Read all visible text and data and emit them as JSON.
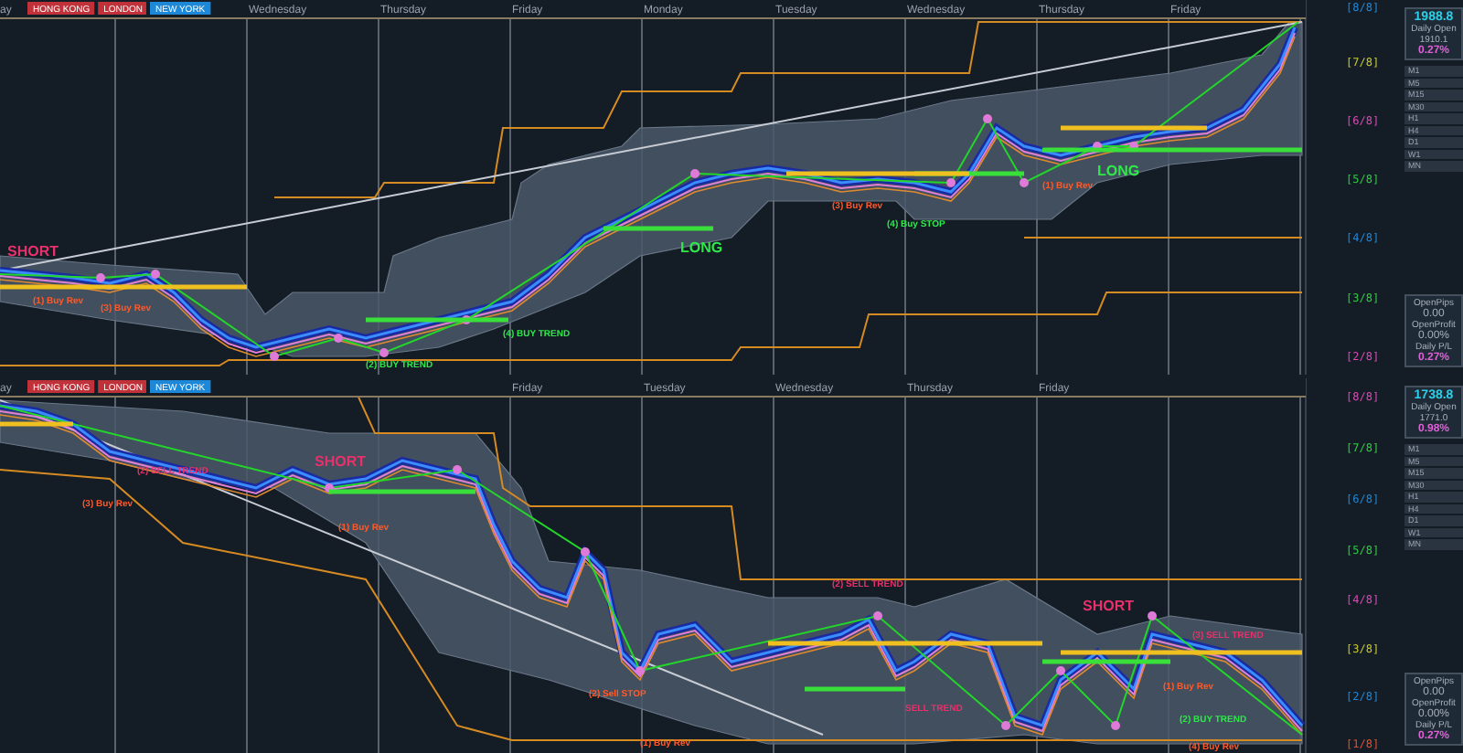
{
  "panels": [
    {
      "day_labels": [
        "ay",
        "Wednesday",
        "Thursday",
        "Friday",
        "Monday",
        "Tuesday",
        "Wednesday",
        "Thursday",
        "Friday"
      ],
      "session_badges": [
        {
          "text": "HONG KONG",
          "color": "#c0313a"
        },
        {
          "text": "LONDON",
          "color": "#c0313a"
        },
        {
          "text": "NEW YORK",
          "color": "#1e88d8"
        }
      ],
      "annotations": [
        {
          "text": "SHORT",
          "kind": "short"
        },
        {
          "text": "(1) Buy Rev",
          "kind": "rev"
        },
        {
          "text": "(3) Buy Rev",
          "kind": "rev"
        },
        {
          "text": "(2) BUY TREND",
          "kind": "trend"
        },
        {
          "text": "(4) BUY TREND",
          "kind": "trend"
        },
        {
          "text": "LONG",
          "kind": "long"
        },
        {
          "text": "(3) Buy Rev",
          "kind": "rev"
        },
        {
          "text": "(4) Buy STOP",
          "kind": "trend"
        },
        {
          "text": "(1) Buy Rev",
          "kind": "rev"
        },
        {
          "text": "LONG",
          "kind": "long"
        }
      ],
      "levels": [
        {
          "text": "[8/8]",
          "color": "#1e88d8"
        },
        {
          "text": "[7/8]",
          "color": "#c8c832"
        },
        {
          "text": "[6/8]",
          "color": "#d84ab4"
        },
        {
          "text": "[5/8]",
          "color": "#2ecc40"
        },
        {
          "text": "[4/8]",
          "color": "#1e88d8"
        },
        {
          "text": "[3/8]",
          "color": "#2ecc40"
        },
        {
          "text": "[2/8]",
          "color": "#d84ab4"
        }
      ],
      "quote_box": [
        "1988.8",
        "Daily Open",
        "1910.1",
        "0.27%"
      ],
      "timeframes": [
        "M1",
        "M5",
        "M15",
        "M30",
        "H1",
        "H4",
        "D1",
        "W1",
        "MN"
      ],
      "pnl_box": [
        "OpenPips",
        "0.00",
        "OpenProfit",
        "0.00%",
        "Daily P/L",
        "0.27%"
      ]
    },
    {
      "day_labels": [
        "ay",
        "Friday",
        "Tuesday",
        "Wednesday",
        "Thursday",
        "Friday"
      ],
      "session_badges": [
        {
          "text": "HONG KONG",
          "color": "#c0313a"
        },
        {
          "text": "LONDON",
          "color": "#c0313a"
        },
        {
          "text": "NEW YORK",
          "color": "#1e88d8"
        }
      ],
      "annotations": [
        {
          "text": "(2) SELL TREND",
          "kind": "short"
        },
        {
          "text": "(3) Buy Rev",
          "kind": "rev"
        },
        {
          "text": "SHORT",
          "kind": "short"
        },
        {
          "text": "(1) Buy Rev",
          "kind": "rev"
        },
        {
          "text": "(2) SELL TREND",
          "kind": "short"
        },
        {
          "text": "(2) Sell STOP",
          "kind": "rev"
        },
        {
          "text": "(1) Buy Rev",
          "kind": "rev"
        },
        {
          "text": "SELL TREND",
          "kind": "short"
        },
        {
          "text": "SHORT",
          "kind": "short"
        },
        {
          "text": "(3) SELL TREND",
          "kind": "short"
        },
        {
          "text": "(1) Buy Rev",
          "kind": "rev"
        },
        {
          "text": "(2) BUY TREND",
          "kind": "trend"
        },
        {
          "text": "(4) Buy Rev",
          "kind": "rev"
        }
      ],
      "levels": [
        {
          "text": "[8/8]",
          "color": "#d84ab4"
        },
        {
          "text": "[7/8]",
          "color": "#2ecc40"
        },
        {
          "text": "[6/8]",
          "color": "#1e88d8"
        },
        {
          "text": "[5/8]",
          "color": "#2ecc40"
        },
        {
          "text": "[4/8]",
          "color": "#d84ab4"
        },
        {
          "text": "[3/8]",
          "color": "#c8c832"
        },
        {
          "text": "[2/8]",
          "color": "#1e88d8"
        },
        {
          "text": "[1/8]",
          "color": "#e0502a"
        }
      ],
      "quote_box": [
        "1738.8",
        "Daily Open",
        "1771.0",
        "0.98%"
      ],
      "timeframes": [
        "M1",
        "M5",
        "M15",
        "M30",
        "H1",
        "H4",
        "D1",
        "W1",
        "MN"
      ],
      "pnl_box": [
        "OpenPips",
        "0.00",
        "OpenProfit",
        "0.00%",
        "Daily P/L",
        "0.27%"
      ]
    }
  ]
}
